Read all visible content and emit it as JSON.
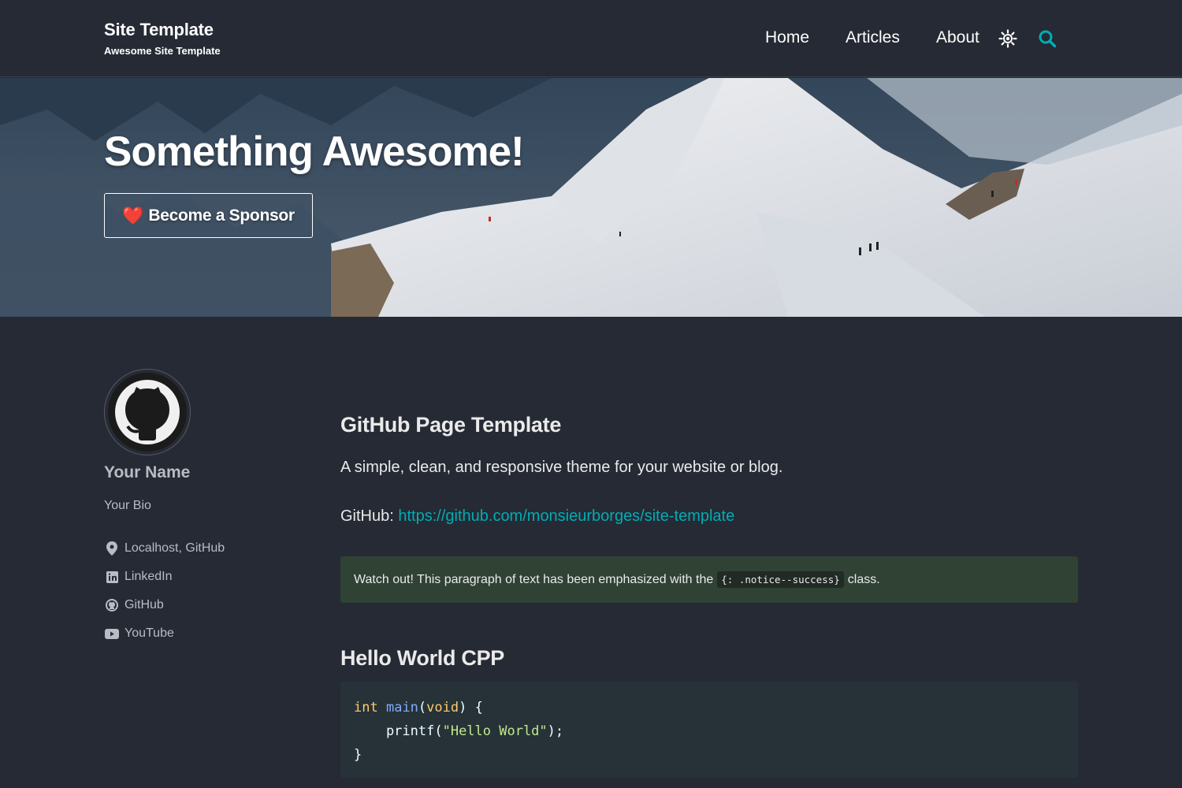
{
  "header": {
    "site_title": "Site Template",
    "site_subtitle": "Awesome Site Template",
    "nav": [
      {
        "label": "Home"
      },
      {
        "label": "Articles"
      },
      {
        "label": "About"
      }
    ],
    "theme_icon": "sun-icon",
    "search_icon": "search-icon"
  },
  "hero": {
    "title": "Something Awesome!",
    "button_icon": "❤️",
    "button_label": "Become a Sponsor"
  },
  "sidebar": {
    "avatar_icon": "github-octocat-icon",
    "name": "Your Name",
    "bio": "Your Bio",
    "links": [
      {
        "icon": "map-marker-icon",
        "label": "Localhost, GitHub"
      },
      {
        "icon": "linkedin-icon",
        "label": "LinkedIn"
      },
      {
        "icon": "github-icon",
        "label": "GitHub"
      },
      {
        "icon": "youtube-icon",
        "label": "YouTube"
      }
    ]
  },
  "content": {
    "heading": "GitHub Page Template",
    "description": "A simple, clean, and responsive theme for your website or blog.",
    "github_prefix": "GitHub: ",
    "github_url": "https://github.com/monsieurborges/site-template",
    "notice_before": "Watch out! This paragraph of text has been emphasized with the",
    "notice_code": "{: .notice--success}",
    "notice_after": "class.",
    "code_heading": "Hello World CPP",
    "code": {
      "line1_kw": "int",
      "line1_fn": "main",
      "line1_open": "(",
      "line1_void": "void",
      "line1_close": ") {",
      "line2_indent": "    printf(",
      "line2_str": "\"Hello World\"",
      "line2_end": ");",
      "line3": "}"
    }
  },
  "colors": {
    "background": "#252a34",
    "accent": "#00adb5",
    "notice_bg": "#2f4234",
    "code_bg": "#263238"
  }
}
